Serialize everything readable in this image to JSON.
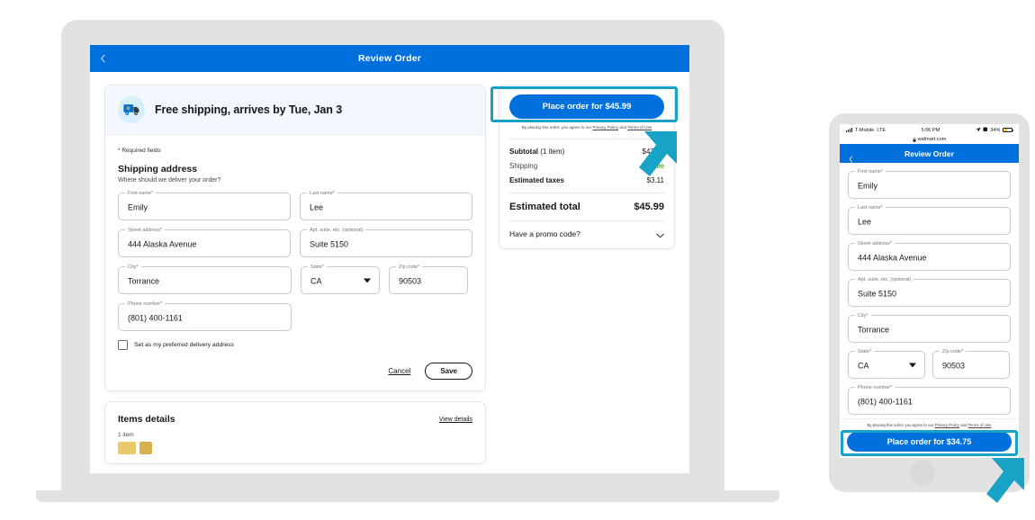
{
  "accent": {
    "brand_blue": "#0071dc",
    "highlight_teal": "#17a2c6",
    "free_green": "#2a8703",
    "device_gray": "#e2e2e2"
  },
  "desktop": {
    "header": {
      "title": "Review Order",
      "back_icon": "chevron-left-icon"
    },
    "shipping_banner": {
      "icon": "delivery-truck-icon",
      "text": "Free shipping, arrives by Tue, Jan 3"
    },
    "form": {
      "required_note": "* Required fields",
      "section_title": "Shipping address",
      "section_subtitle": "Where should we deliver your order?",
      "fields": [
        {
          "label": "First name*",
          "value": "Emily"
        },
        {
          "label": "Last name*",
          "value": "Lee"
        },
        {
          "label": "Street address*",
          "value": "444 Alaska Avenue"
        },
        {
          "label": "Apt, suite, etc. (optional)",
          "value": "Suite 5150"
        },
        {
          "label": "City*",
          "value": "Torrance"
        },
        {
          "label": "State*",
          "value": "CA"
        },
        {
          "label": "Zip code*",
          "value": "90503"
        },
        {
          "label": "Phone number*",
          "value": "(801) 400-1161"
        }
      ],
      "checkbox_label": "Set as my preferred delivery address",
      "cancel_label": "Cancel",
      "save_label": "Save"
    },
    "items": {
      "title": "Items details",
      "view_details": "View details",
      "count": "1 item"
    },
    "summary": {
      "place_order_label": "Place order for $45.99",
      "terms_prefix": "By placing this order, you agree to our ",
      "terms_privacy": "Privacy Policy",
      "terms_mid": " and ",
      "terms_use": "Terms of Use",
      "rows": [
        {
          "label_bold": "Subtotal",
          "label_rest": " (1 item)",
          "value": "$42.88",
          "value_style": "normal"
        },
        {
          "label_bold": "",
          "label_rest": "Shipping",
          "value": "Free",
          "value_style": "free"
        },
        {
          "label_bold": "Estimated taxes",
          "label_rest": "",
          "value": "$3.11",
          "value_style": "normal"
        }
      ],
      "total_label": "Estimated total",
      "total_value": "$45.99",
      "promo_label": "Have a promo code?",
      "promo_icon": "chevron-down-icon"
    }
  },
  "phone": {
    "status_bar": {
      "carrier": "T-Mobile",
      "network": "LTE",
      "time": "5:06 PM",
      "battery": "34%",
      "signal_icon": "signal-bars-icon",
      "location_icon": "location-arrow-icon",
      "alarm_icon": "alarm-icon",
      "battery_icon": "battery-icon"
    },
    "url_bar": {
      "lock_icon": "lock-icon",
      "url": "walmart.com"
    },
    "header": {
      "title": "Review Order",
      "back_icon": "chevron-left-icon"
    },
    "fields": [
      {
        "label": "First name*",
        "value": "Emily"
      },
      {
        "label": "Last name*",
        "value": "Lee"
      },
      {
        "label": "Street address*",
        "value": "444 Alaska Avenue"
      },
      {
        "label": "Apt, suite, etc. (optional)",
        "value": "Suite 5150"
      },
      {
        "label": "City*",
        "value": "Torrance"
      },
      {
        "label": "State*",
        "value": "CA"
      },
      {
        "label": "Zip code*",
        "value": "90503"
      },
      {
        "label": "Phone number*",
        "value": "(801) 400-1161"
      }
    ],
    "terms_prefix": "By placing this order, you agree to our ",
    "terms_privacy": "Privacy Policy",
    "terms_mid": " and ",
    "terms_use": "Terms of Use",
    "place_order_label": "Place order for $34.75"
  }
}
